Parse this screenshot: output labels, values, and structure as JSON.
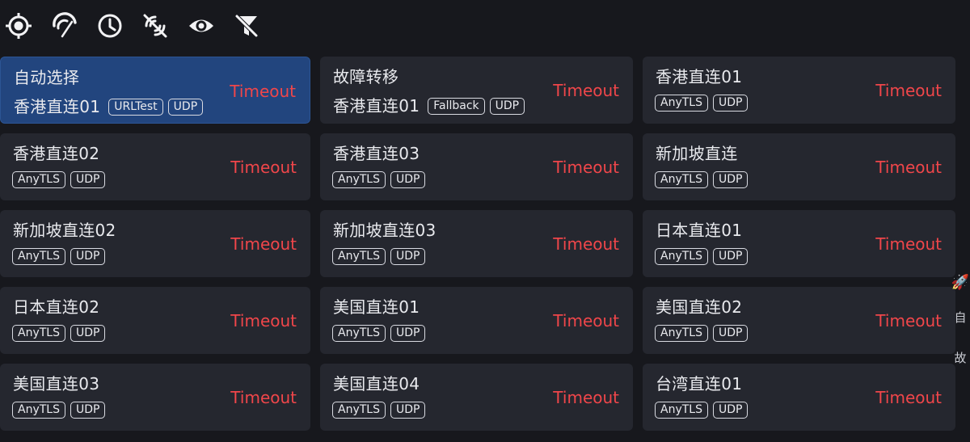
{
  "toolbar": {
    "icons": [
      {
        "name": "locate-icon"
      },
      {
        "name": "speed-test-icon"
      },
      {
        "name": "history-clock-icon"
      },
      {
        "name": "no-signal-icon"
      },
      {
        "name": "visibility-eye-icon"
      },
      {
        "name": "filter-off-icon"
      }
    ]
  },
  "colors": {
    "background": "#17181d",
    "card": "#25272f",
    "selected_card": "#22457e",
    "timeout": "#f0464a"
  },
  "proxies": [
    {
      "name": "自动选择",
      "now": "香港直连01",
      "tags": [
        "URLTest",
        "UDP"
      ],
      "delay": "Timeout",
      "selected": true
    },
    {
      "name": "故障转移",
      "now": "香港直连01",
      "tags": [
        "Fallback",
        "UDP"
      ],
      "delay": "Timeout",
      "selected": false
    },
    {
      "name": "香港直连01",
      "now": "",
      "tags": [
        "AnyTLS",
        "UDP"
      ],
      "delay": "Timeout",
      "selected": false
    },
    {
      "name": "香港直连02",
      "now": "",
      "tags": [
        "AnyTLS",
        "UDP"
      ],
      "delay": "Timeout",
      "selected": false
    },
    {
      "name": "香港直连03",
      "now": "",
      "tags": [
        "AnyTLS",
        "UDP"
      ],
      "delay": "Timeout",
      "selected": false
    },
    {
      "name": "新加坡直连",
      "now": "",
      "tags": [
        "AnyTLS",
        "UDP"
      ],
      "delay": "Timeout",
      "selected": false
    },
    {
      "name": "新加坡直连02",
      "now": "",
      "tags": [
        "AnyTLS",
        "UDP"
      ],
      "delay": "Timeout",
      "selected": false
    },
    {
      "name": "新加坡直连03",
      "now": "",
      "tags": [
        "AnyTLS",
        "UDP"
      ],
      "delay": "Timeout",
      "selected": false
    },
    {
      "name": "日本直连01",
      "now": "",
      "tags": [
        "AnyTLS",
        "UDP"
      ],
      "delay": "Timeout",
      "selected": false
    },
    {
      "name": "日本直连02",
      "now": "",
      "tags": [
        "AnyTLS",
        "UDP"
      ],
      "delay": "Timeout",
      "selected": false
    },
    {
      "name": "美国直连01",
      "now": "",
      "tags": [
        "AnyTLS",
        "UDP"
      ],
      "delay": "Timeout",
      "selected": false
    },
    {
      "name": "美国直连02",
      "now": "",
      "tags": [
        "AnyTLS",
        "UDP"
      ],
      "delay": "Timeout",
      "selected": false
    },
    {
      "name": "美国直连03",
      "now": "",
      "tags": [
        "AnyTLS",
        "UDP"
      ],
      "delay": "Timeout",
      "selected": false
    },
    {
      "name": "美国直连04",
      "now": "",
      "tags": [
        "AnyTLS",
        "UDP"
      ],
      "delay": "Timeout",
      "selected": false
    },
    {
      "name": "台湾直连01",
      "now": "",
      "tags": [
        "AnyTLS",
        "UDP"
      ],
      "delay": "Timeout",
      "selected": false
    }
  ],
  "side_nav": {
    "icon": "🚀",
    "items": [
      "自",
      "故"
    ]
  }
}
